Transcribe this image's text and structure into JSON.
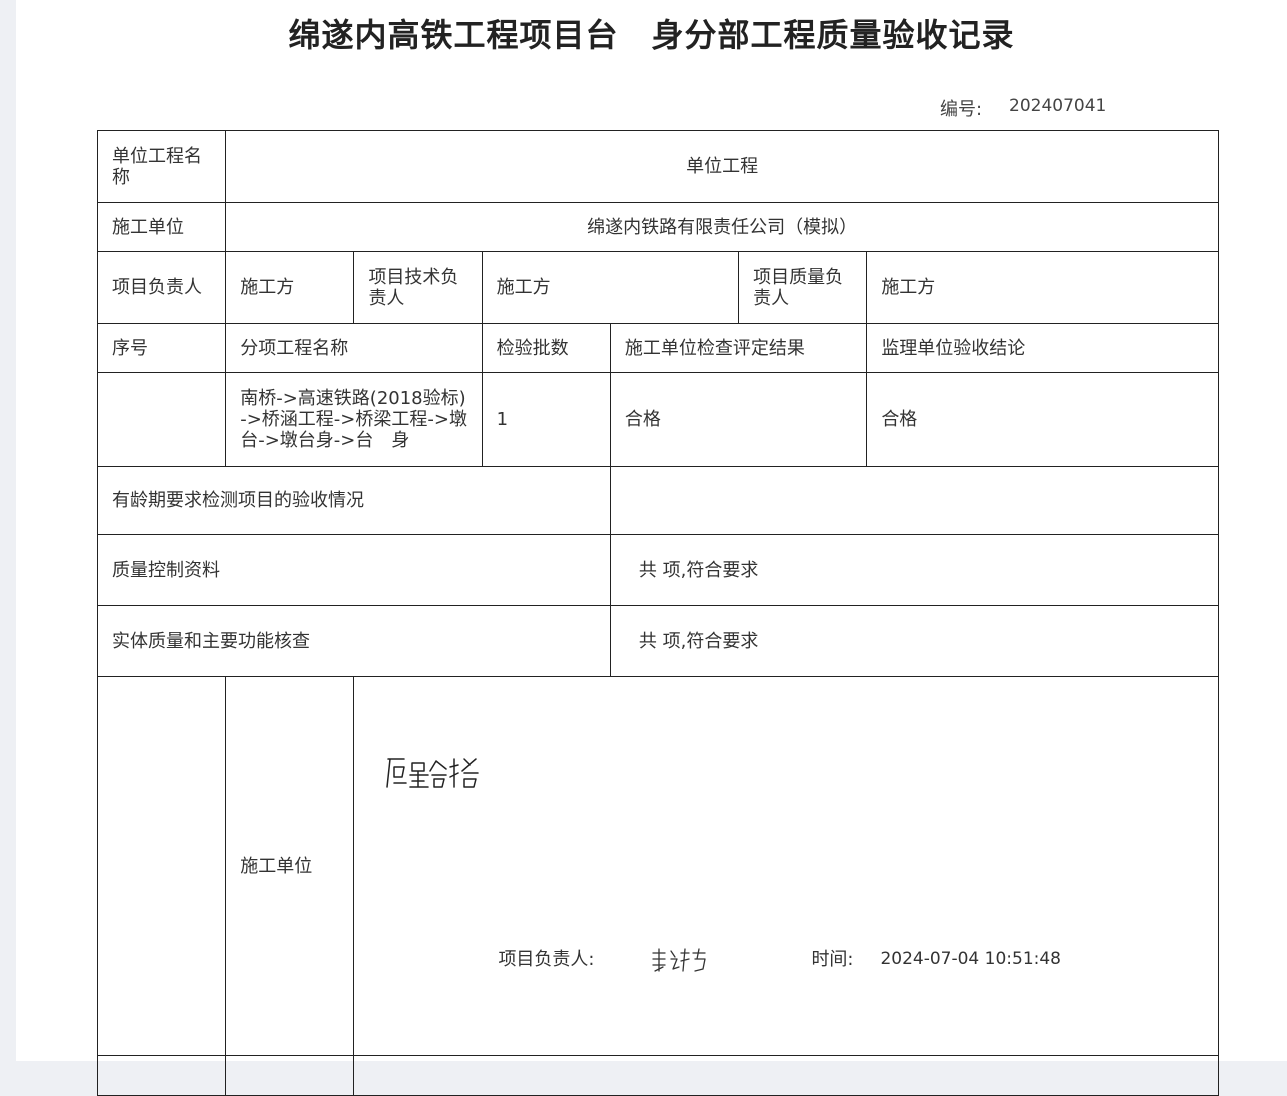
{
  "title": "绵遂内高铁工程项目台　身分部工程质量验收记录",
  "code": {
    "label": "编号:",
    "value": "202407041"
  },
  "rows": {
    "unit_project": {
      "label": "单位工程名称",
      "value": "单位工程"
    },
    "construction_unit": {
      "label": "施工单位",
      "value": "绵遂内铁路有限责任公司（模拟）"
    },
    "managers": {
      "pm_label": "项目负责人",
      "pm_value": "施工方",
      "tech_label": "项目技术负责人",
      "tech_value": "施工方",
      "quality_label": "项目质量负责人",
      "quality_value": "施工方"
    },
    "headers": {
      "seq": "序号",
      "item_name": "分项工程名称",
      "batch_count": "检验批数",
      "unit_result": "施工单位检查评定结果",
      "supervisor_result": "监理单位验收结论"
    },
    "items": [
      {
        "seq": "",
        "item_name": "南桥->高速铁路(2018验标)->桥涵工程->桥梁工程->墩 台->墩台身->台　身",
        "batch_count": "1",
        "unit_result": "合格",
        "supervisor_result": "合格"
      }
    ],
    "age_testing": {
      "label": "有龄期要求检测项目的验收情况",
      "value": ""
    },
    "quality_docs": {
      "label": "质量控制资料",
      "value": "共  项,符合要求"
    },
    "function_check": {
      "label": "实体质量和主要功能核查",
      "value": "共  项,符合要求"
    }
  },
  "signoff": {
    "role": "施工单位",
    "handwritten_note": "质量合格",
    "pm_label": "项目负责人:",
    "time_label": "时间:",
    "time_value": "2024-07-04 10:51:48"
  }
}
